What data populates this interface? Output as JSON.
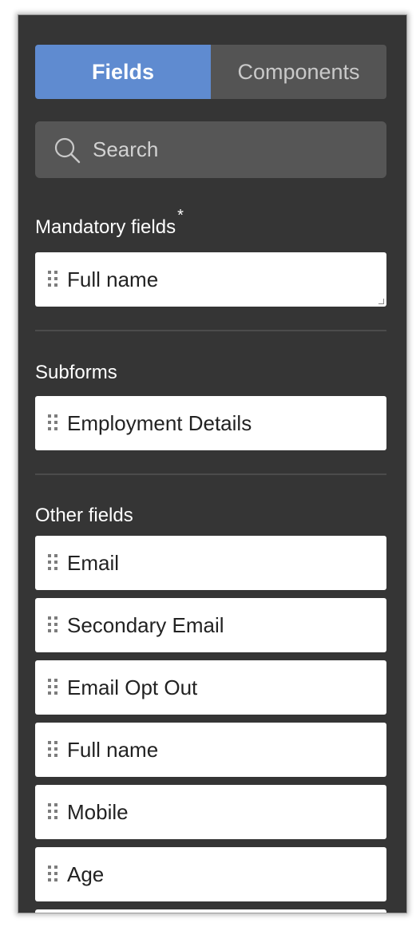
{
  "tabs": {
    "fields_label": "Fields",
    "components_label": "Components"
  },
  "search": {
    "placeholder": "Search"
  },
  "mandatory": {
    "title": "Mandatory fields",
    "asterisk": "*",
    "items": [
      "Full name"
    ]
  },
  "subforms": {
    "title": "Subforms",
    "items": [
      "Employment Details"
    ]
  },
  "other": {
    "title": "Other fields",
    "items": [
      "Email",
      "Secondary Email",
      "Email Opt Out",
      "Full name",
      "Mobile",
      "Age"
    ]
  },
  "colors": {
    "panel_bg": "#353535",
    "tab_active": "#5f8bd0",
    "tab_inactive": "#545454",
    "search_bg": "#565656",
    "field_bg": "#ffffff"
  },
  "icons": {
    "search": "search-icon",
    "drag": "drag-handle-icon"
  }
}
